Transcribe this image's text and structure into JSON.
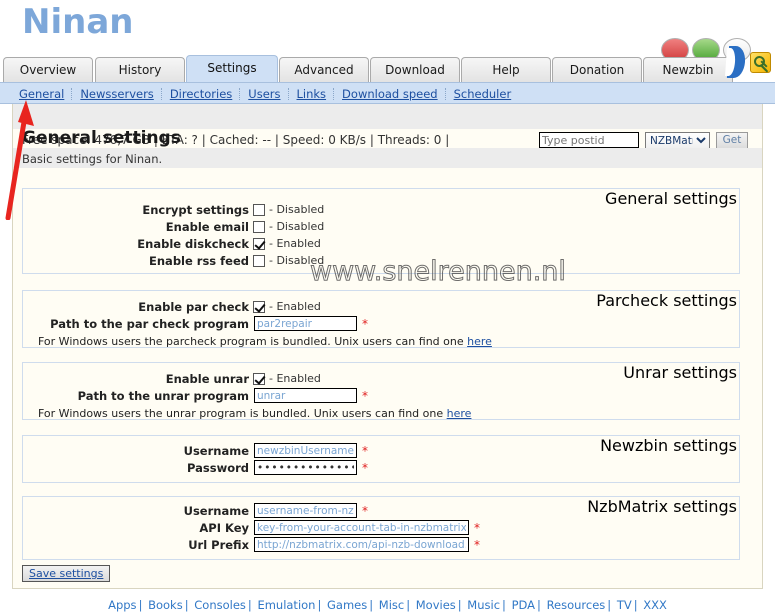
{
  "app": {
    "title": "Ninan"
  },
  "status_icons": [
    {
      "name": "status-dot-red",
      "color": "#d03b3b"
    },
    {
      "name": "status-dot-green",
      "color": "#4aa333"
    },
    {
      "name": "status-dot-grey",
      "color": "#e9e9e9"
    }
  ],
  "tabs": [
    {
      "label": "Overview",
      "active": false
    },
    {
      "label": "History",
      "active": false
    },
    {
      "label": "Settings",
      "active": true
    },
    {
      "label": "Advanced",
      "active": false
    },
    {
      "label": "Download",
      "active": false
    },
    {
      "label": "Help",
      "active": false
    },
    {
      "label": "Donation",
      "active": false
    },
    {
      "label": "Newzbin",
      "active": false
    }
  ],
  "subnav": [
    {
      "label": "General",
      "active": true
    },
    {
      "label": "Newsservers",
      "active": false
    },
    {
      "label": "Directories",
      "active": false
    },
    {
      "label": "Users",
      "active": false
    },
    {
      "label": "Links",
      "active": false
    },
    {
      "label": "Download speed",
      "active": false
    },
    {
      "label": "Scheduler",
      "active": false
    }
  ],
  "statusbar": {
    "text": "Free space: 476,7 GB | ETA: ? | Cached: -- | Speed: 0 KB/s | Threads: 0 |",
    "postid_placeholder": "Type postid",
    "postid_value": "",
    "site_selected": "NZBMatrix",
    "get_label": "Get"
  },
  "page": {
    "title": "General settings",
    "subtitle": "Basic settings for Ninan."
  },
  "watermark": "www.snelrennen.nl",
  "sections": {
    "general": {
      "legend": "General settings",
      "rows": [
        {
          "label": "Encrypt settings",
          "checked": false,
          "state": "- Disabled"
        },
        {
          "label": "Enable email",
          "checked": false,
          "state": "- Disabled"
        },
        {
          "label": "Enable diskcheck",
          "checked": true,
          "state": "- Enabled"
        },
        {
          "label": "Enable rss feed",
          "checked": false,
          "state": "- Disabled"
        }
      ]
    },
    "parcheck": {
      "legend": "Parcheck settings",
      "check_label": "Enable par check",
      "check_state": "- Enabled",
      "checked": true,
      "path_label": "Path to the par check program",
      "path_value": "par2repair",
      "required_mark": "*",
      "hint_before": "For Windows users the parcheck program is bundled. Unix users can find one ",
      "hint_link": "here"
    },
    "unrar": {
      "legend": "Unrar settings",
      "check_label": "Enable unrar",
      "check_state": "- Enabled",
      "checked": true,
      "path_label": "Path to the unrar program",
      "path_value": "unrar",
      "required_mark": "*",
      "hint_before": "For Windows users the unrar program is bundled. Unix users can find one ",
      "hint_link": "here"
    },
    "newzbin": {
      "legend": "Newzbin settings",
      "username_label": "Username",
      "username_value": "newzbinUsername",
      "password_label": "Password",
      "password_value": "••••••••••••••",
      "required_mark": "*"
    },
    "nzbmatrix": {
      "legend": "NzbMatrix settings",
      "username_label": "Username",
      "username_value": "username-from-nzb-ma",
      "apikey_label": "API Key",
      "apikey_value": "key-from-your-account-tab-in-nzbmatrix",
      "urlprefix_label": "Url Prefix",
      "urlprefix_value": "http://nzbmatrix.com/api-nzb-download.php",
      "required_mark": "*"
    }
  },
  "save": {
    "label": "Save settings"
  },
  "footer": {
    "links": [
      "Apps",
      "Books",
      "Consoles",
      "Emulation",
      "Games",
      "Misc",
      "Movies",
      "Music",
      "PDA",
      "Resources",
      "TV",
      "XXX"
    ],
    "separator": "|"
  },
  "annotation": {
    "arrow_color": "#e8251f",
    "points_to": "General"
  }
}
